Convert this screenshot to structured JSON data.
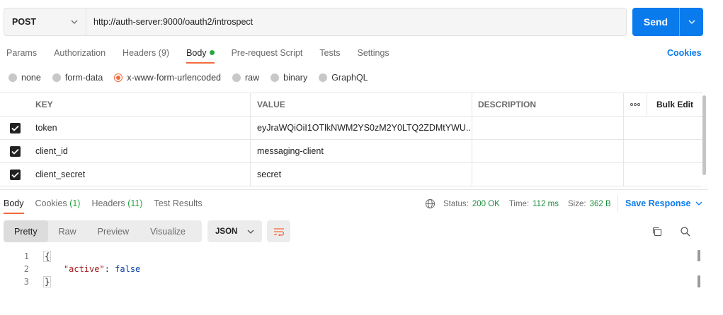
{
  "request": {
    "method": "POST",
    "url": "http://auth-server:9000/oauth2/introspect",
    "send_label": "Send"
  },
  "request_tabs": [
    {
      "label": "Params"
    },
    {
      "label": "Authorization"
    },
    {
      "label": "Headers",
      "count": "(9)"
    },
    {
      "label": "Body"
    },
    {
      "label": "Pre-request Script"
    },
    {
      "label": "Tests"
    },
    {
      "label": "Settings"
    }
  ],
  "cookies_label": "Cookies",
  "body_types": [
    "none",
    "form-data",
    "x-www-form-urlencoded",
    "raw",
    "binary",
    "GraphQL"
  ],
  "params_table": {
    "headers": {
      "key": "KEY",
      "value": "VALUE",
      "description": "DESCRIPTION",
      "more": "ooo",
      "bulk_edit": "Bulk Edit"
    },
    "rows": [
      {
        "key": "token",
        "value": "eyJraWQiOiI1OTlkNWM2YS0zM2Y0LTQ2ZDMtYWU...",
        "description": ""
      },
      {
        "key": "client_id",
        "value": "messaging-client",
        "description": ""
      },
      {
        "key": "client_secret",
        "value": "secret",
        "description": ""
      }
    ]
  },
  "response": {
    "tabs": [
      {
        "label": "Body"
      },
      {
        "label": "Cookies",
        "count": "(1)"
      },
      {
        "label": "Headers",
        "count": "(11)"
      },
      {
        "label": "Test Results"
      }
    ],
    "status_label": "Status:",
    "status_value": "200 OK",
    "time_label": "Time:",
    "time_value": "112 ms",
    "size_label": "Size:",
    "size_value": "362 B",
    "save_label": "Save Response",
    "view_tabs": [
      "Pretty",
      "Raw",
      "Preview",
      "Visualize"
    ],
    "format": "JSON",
    "code": {
      "line_numbers": [
        "1",
        "2",
        "3"
      ],
      "open_brace": "{",
      "key": "\"active\"",
      "colon": ": ",
      "value": "false",
      "close_brace": "}"
    }
  },
  "colors": {
    "accent": "#097bed",
    "active_tab": "#f26b3a",
    "ok": "#1c8b3c"
  }
}
